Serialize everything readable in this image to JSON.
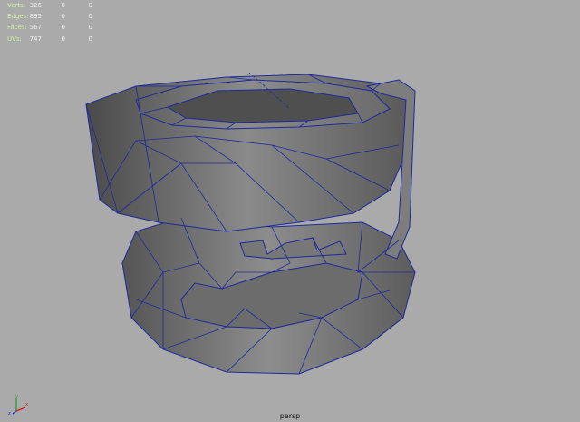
{
  "hud": {
    "rows": [
      {
        "label": "Verts:",
        "total": "326",
        "selected": "0",
        "component": "0"
      },
      {
        "label": "Edges:",
        "total": "895",
        "selected": "0",
        "component": "0"
      },
      {
        "label": "Faces:",
        "total": "567",
        "selected": "0",
        "component": "0"
      },
      {
        "label": "UVs:",
        "total": "747",
        "selected": "0",
        "component": "0"
      }
    ]
  },
  "viewport": {
    "camera_label": "persp",
    "background_color": "#aaaaaa",
    "wireframe_color": "#1e2a9c",
    "shade_color": "#8a8a8a"
  },
  "axis_indicator": {
    "y": "y",
    "x": "x",
    "z": "z"
  }
}
